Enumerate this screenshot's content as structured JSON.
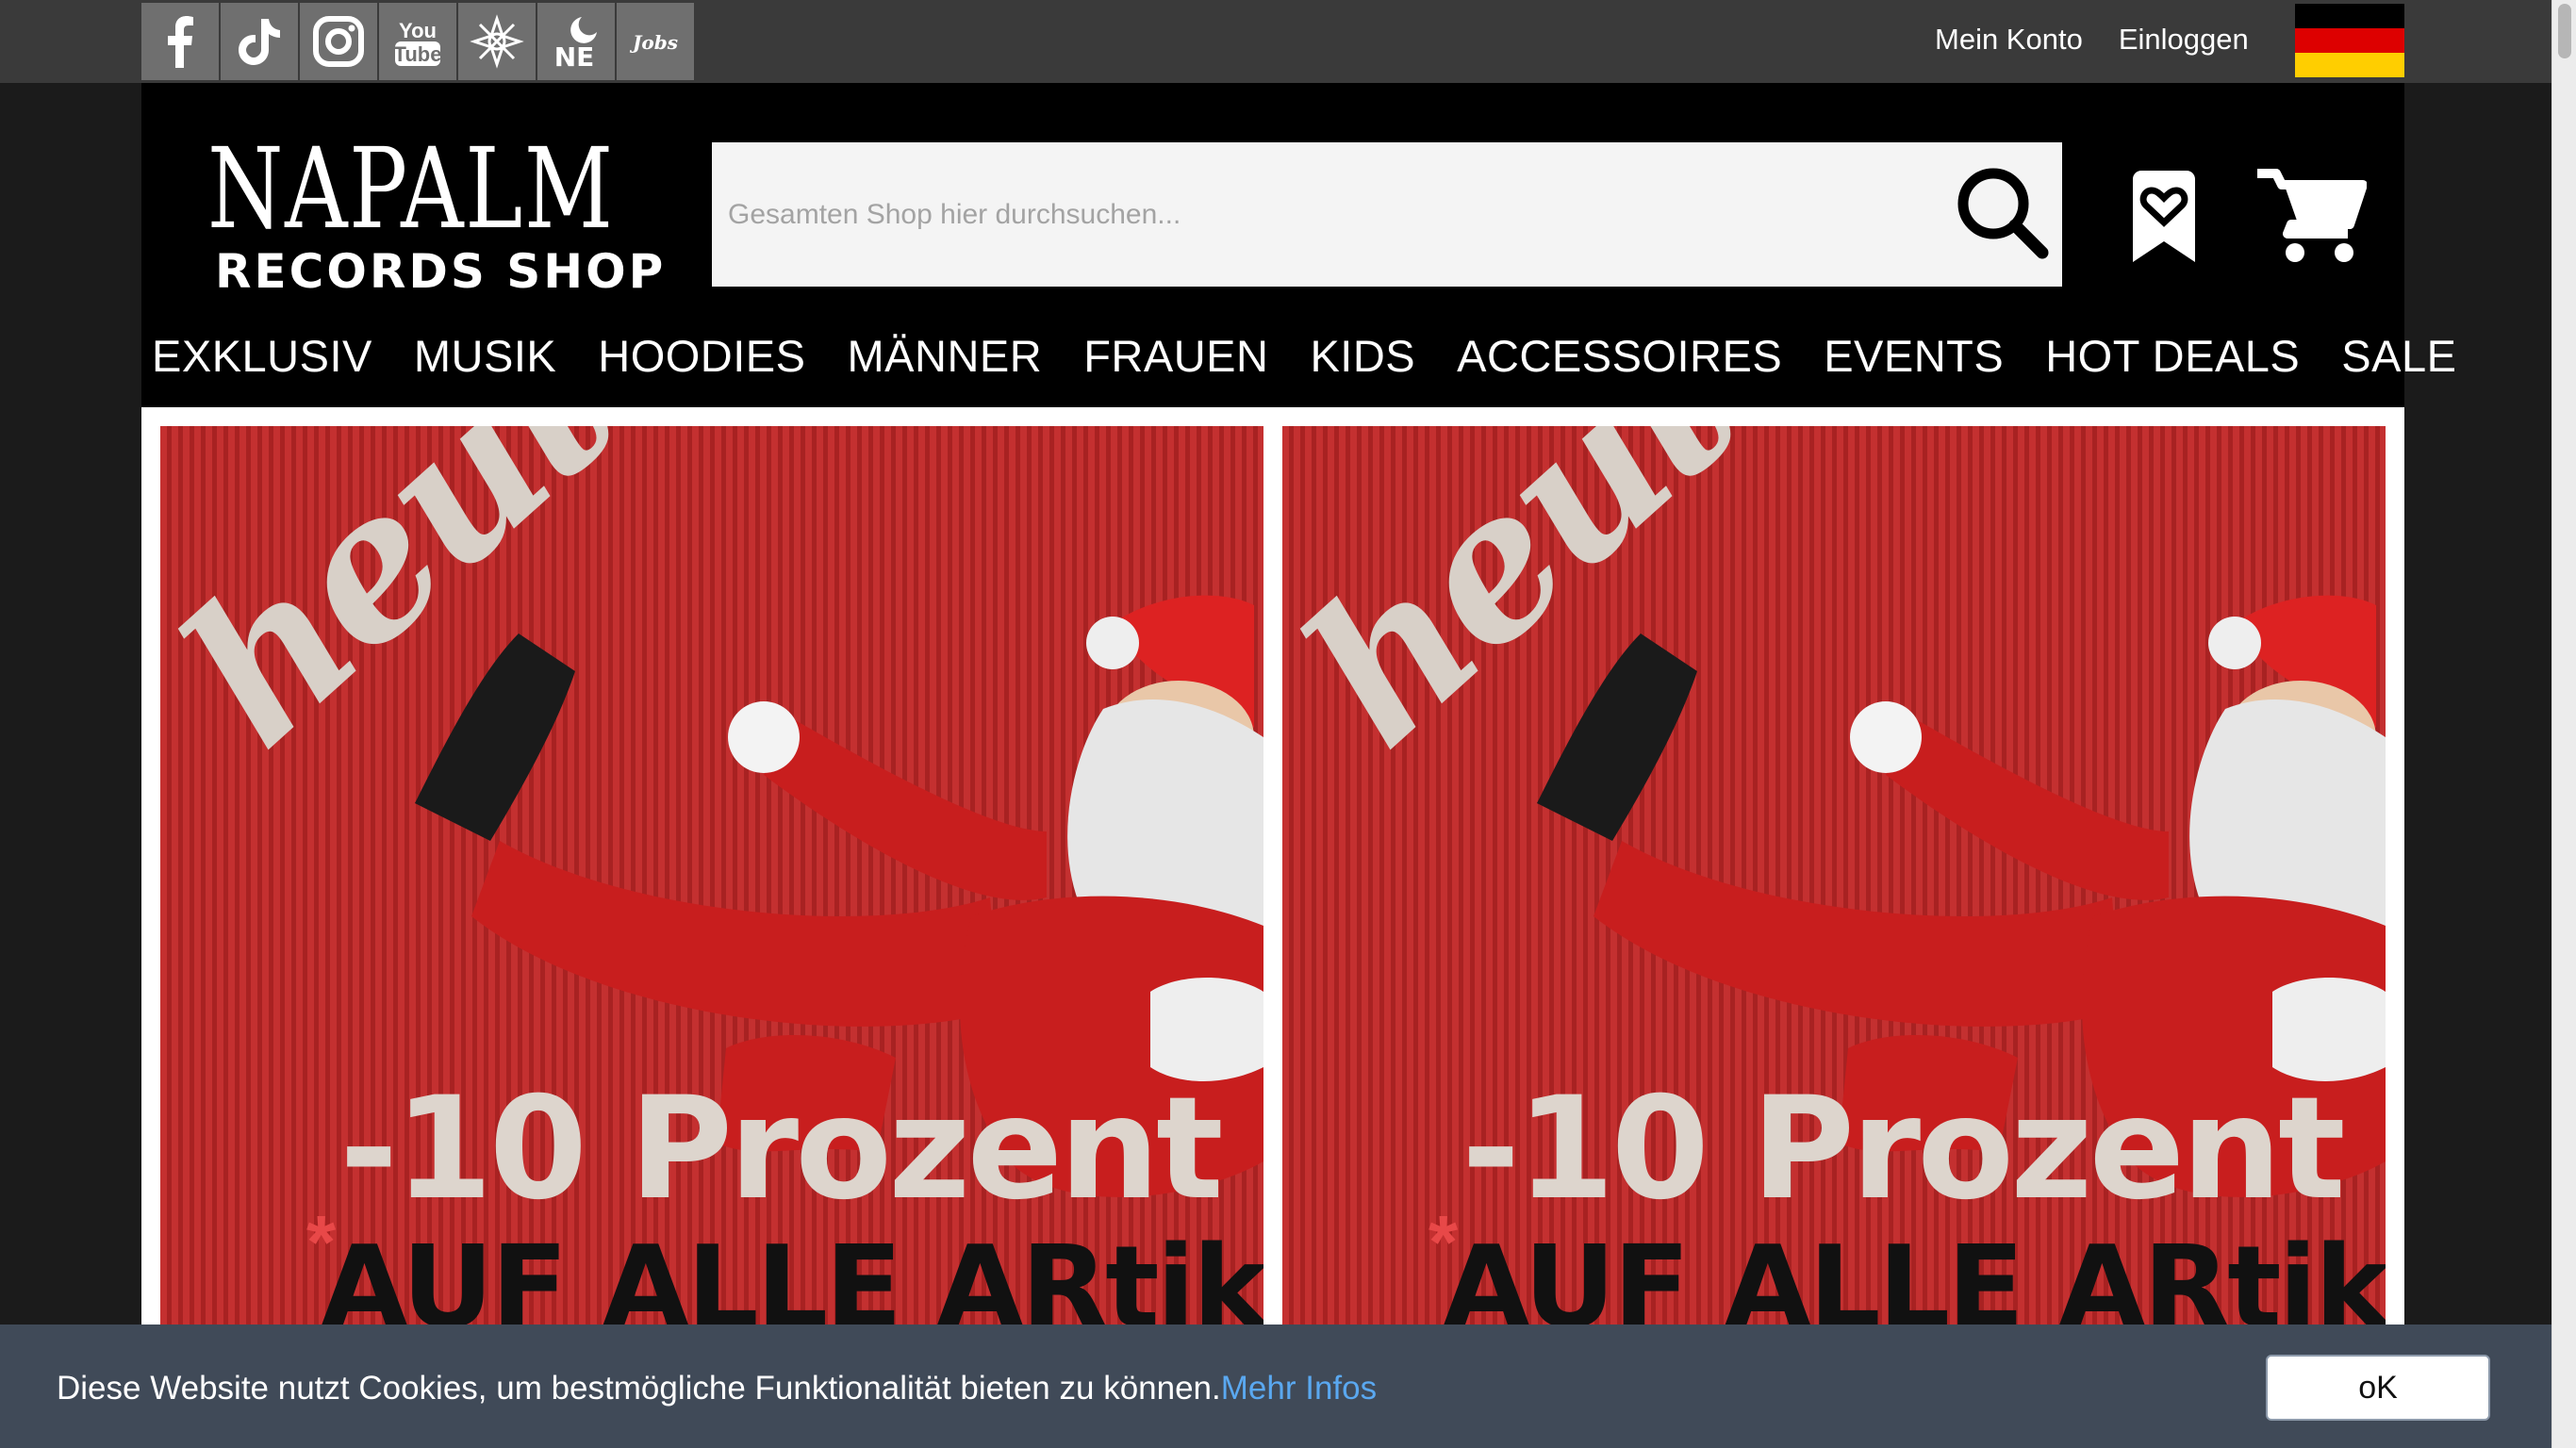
{
  "topbar": {
    "social": [
      {
        "name": "facebook-icon",
        "glyph": "f"
      },
      {
        "name": "tiktok-icon",
        "glyph": "♪"
      },
      {
        "name": "instagram-icon",
        "glyph": ""
      },
      {
        "name": "youtube-icon",
        "glyph": "You Tube"
      },
      {
        "name": "napalm-emblem-icon",
        "glyph": ""
      },
      {
        "name": "ne-icon",
        "glyph": "NE"
      },
      {
        "name": "jobs-icon",
        "glyph": "Jobs"
      }
    ],
    "my_account": "Mein Konto",
    "login": "Einloggen",
    "flag_colors": [
      "#000000",
      "#dd0000",
      "#ffce00"
    ]
  },
  "header": {
    "logo_brand": "NAPALM",
    "logo_sub": "RECORDS SHOP",
    "search_placeholder": "Gesamten Shop hier durchsuchen...",
    "icons": [
      "search-icon",
      "wishlist-icon",
      "cart-icon"
    ]
  },
  "nav": [
    "EXKLUSIV",
    "MUSIK",
    "HOODIES",
    "MÄNNER",
    "FRAUEN",
    "KIDS",
    "ACCESSOIRES",
    "EVENTS",
    "HOT DEALS",
    "SALE"
  ],
  "banners": [
    {
      "heute": "heute",
      "discount": "-10 Prozent",
      "star": "*",
      "all_items": "AUF ALLE ARtikeL"
    },
    {
      "heute": "heute",
      "discount": "-10 Prozent",
      "star": "*",
      "all_items": "AUF ALLE ARtikeL"
    }
  ],
  "cookie": {
    "message": "Diese Website nutzt Cookies, um bestmögliche Funktionalität bieten zu können.",
    "more_link": "Mehr Infos",
    "ok_label": "oK"
  },
  "colors": {
    "topbar": "#3a3a3a",
    "header": "#000000",
    "banner_red": "#c43030",
    "cookie_bar": "#404a58",
    "link_blue": "#5aa8f0"
  }
}
